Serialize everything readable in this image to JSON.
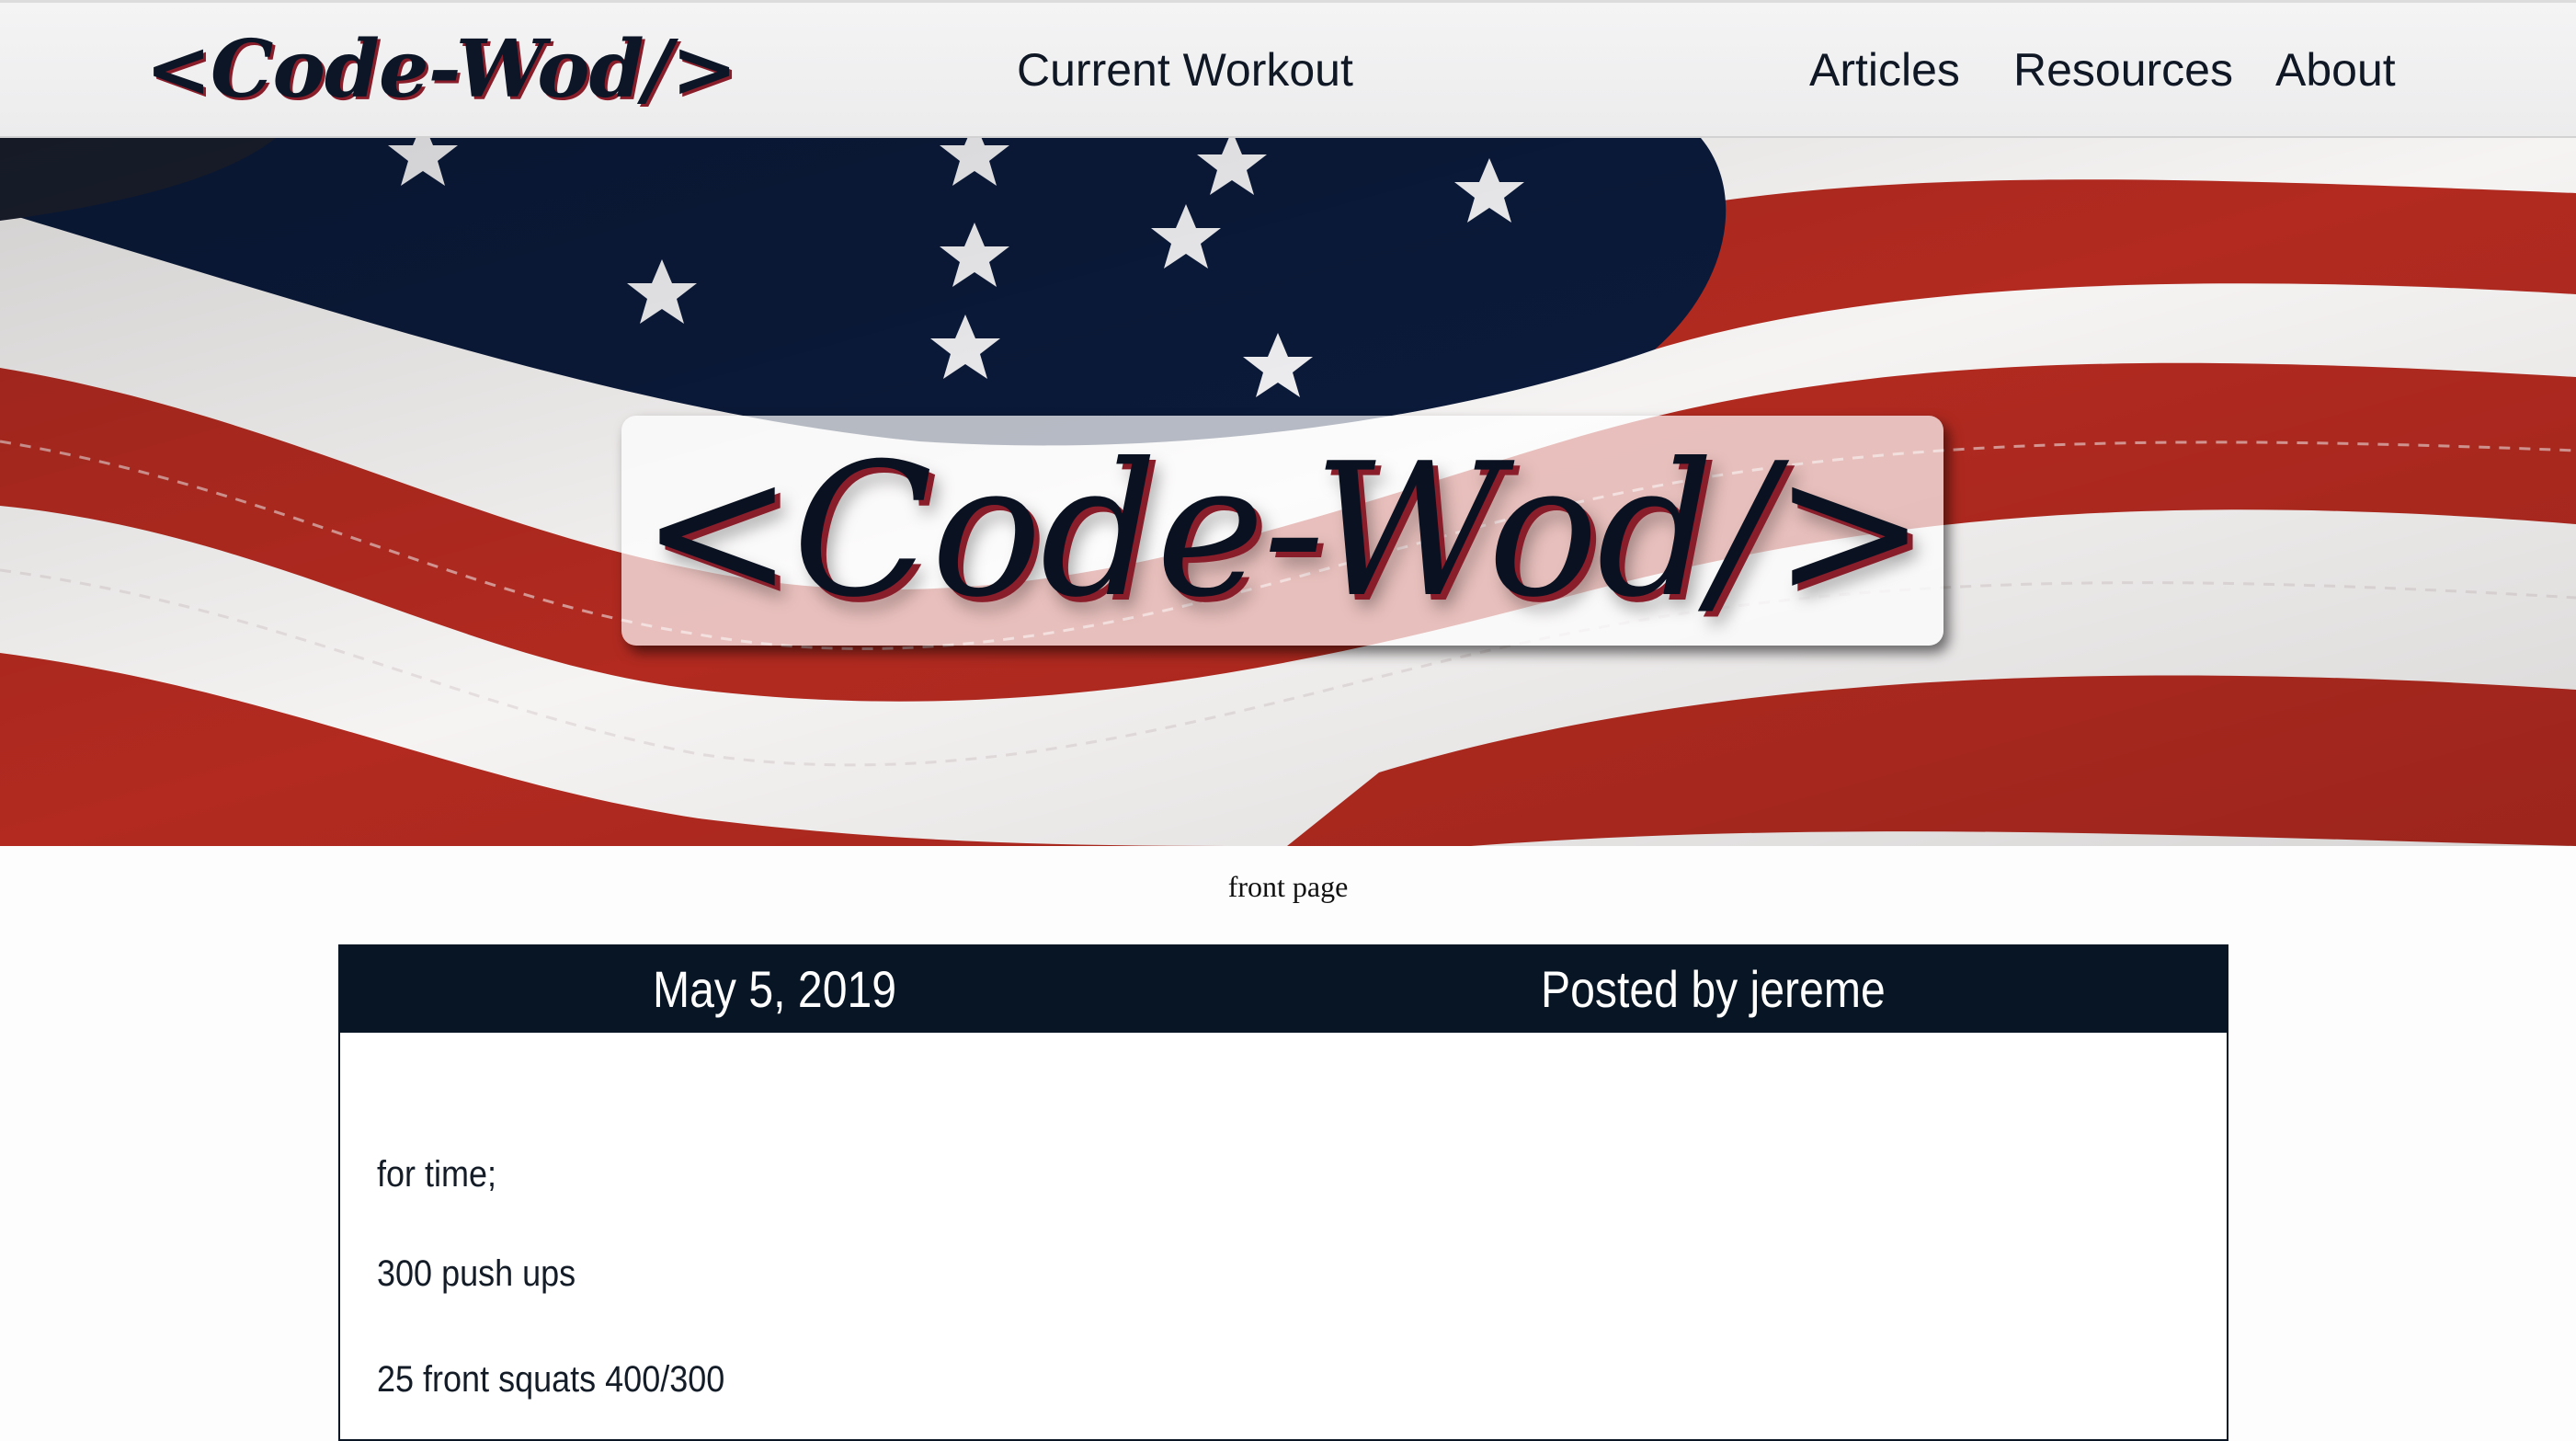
{
  "nav": {
    "logo": "<Code-Wod/>",
    "links": [
      "Current Workout",
      "Articles",
      "Resources",
      "About"
    ]
  },
  "hero": {
    "title": "<Code-Wod/>",
    "background": "american-flag-image"
  },
  "caption": "front page",
  "post": {
    "date": "May 5, 2019",
    "author": "Posted by jereme",
    "lines": [
      "for time;",
      "300 push ups",
      "25 front squats 400/300"
    ]
  },
  "colors": {
    "navy": "#081524",
    "accent_red": "#8a1d2a",
    "flag_red": "#b22a20",
    "flag_blue": "#0b1a3a"
  }
}
